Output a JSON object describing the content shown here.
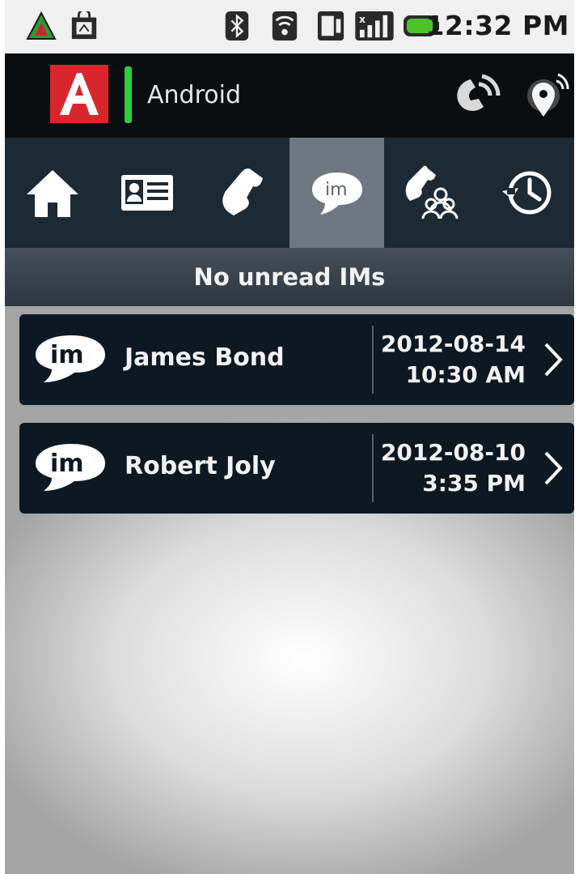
{
  "status_bar": {
    "time": "12:32 PM",
    "icons": [
      "alert-triangle-icon",
      "shopping-bag-icon",
      "bluetooth-icon",
      "wifi-icon",
      "sim-icon",
      "signal-icon",
      "battery-icon"
    ]
  },
  "header": {
    "app_title": "Android",
    "logo_letter": "A",
    "icons": [
      "voicemail-icon",
      "location-icon"
    ]
  },
  "nav": {
    "tabs": [
      "home-icon",
      "contacts-icon",
      "phone-icon",
      "im-icon",
      "conference-icon",
      "history-icon"
    ],
    "active_index": 3
  },
  "status_message": "No unread IMs",
  "conversations": [
    {
      "name": "James Bond",
      "date": "2012-08-14",
      "time": "10:30 AM"
    },
    {
      "name": "Robert Joly",
      "date": "2012-08-10",
      "time": "3:35 PM"
    }
  ],
  "colors": {
    "brand_red": "#d9262c",
    "accent_green": "#2ecc40",
    "header_bg": "#0b0e10",
    "nav_bg": "#1b2a35",
    "row_bg": "#0c1923"
  }
}
